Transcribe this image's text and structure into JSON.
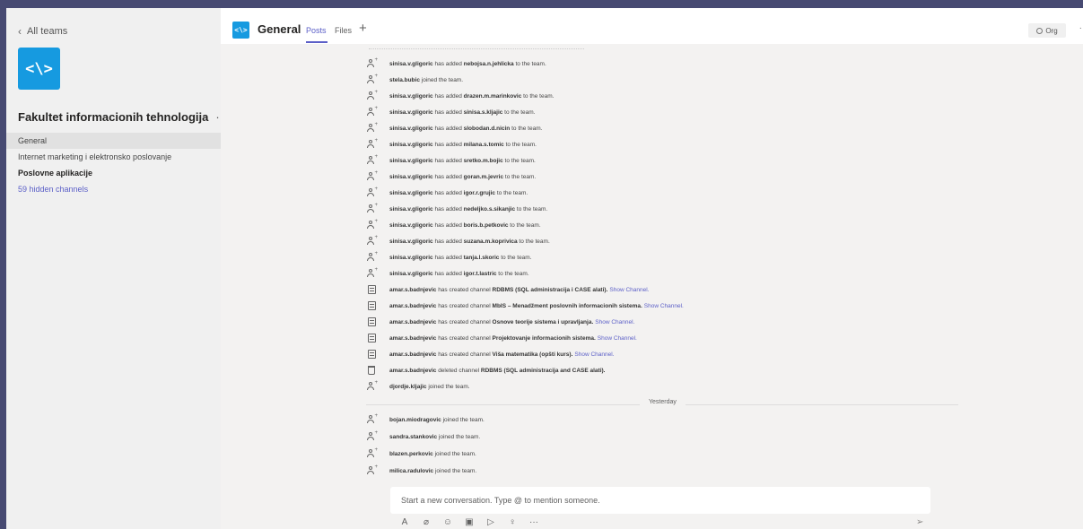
{
  "sidebar": {
    "back_label": "All teams",
    "team_avatar_glyph": "<\\>",
    "team_name": "Fakultet informacionih tehnologija",
    "team_more": "···",
    "channels": [
      {
        "label": "General"
      },
      {
        "label": "Internet marketing i elektronsko poslovanje"
      },
      {
        "label": "Poslovne aplikacije"
      },
      {
        "label": "59 hidden channels"
      }
    ]
  },
  "header": {
    "avatar_glyph": "<\\>",
    "title": "General",
    "tabs": [
      {
        "label": "Posts"
      },
      {
        "label": "Files"
      }
    ],
    "add_tab": "+",
    "org_label": "Org"
  },
  "feed": {
    "events": [
      {
        "icon": "user-add-icon",
        "user": "sinisa.v.gligoric",
        "text": " has added ",
        "target": "nebojsa.n.jehlicka",
        "tail": " to the team."
      },
      {
        "icon": "user-add-icon",
        "user": "stela.bubic",
        "text": " joined the team.",
        "target": "",
        "tail": ""
      },
      {
        "icon": "user-add-icon",
        "user": "sinisa.v.gligoric",
        "text": " has added ",
        "target": "drazen.m.marinkovic",
        "tail": " to the team."
      },
      {
        "icon": "user-add-icon",
        "user": "sinisa.v.gligoric",
        "text": " has added ",
        "target": "sinisa.s.kljajic",
        "tail": " to the team."
      },
      {
        "icon": "user-add-icon",
        "user": "sinisa.v.gligoric",
        "text": " has added ",
        "target": "slobodan.d.nicin",
        "tail": " to the team."
      },
      {
        "icon": "user-add-icon",
        "user": "sinisa.v.gligoric",
        "text": " has added ",
        "target": "milana.s.tomic",
        "tail": " to the team."
      },
      {
        "icon": "user-add-icon",
        "user": "sinisa.v.gligoric",
        "text": " has added ",
        "target": "sretko.m.bojic",
        "tail": " to the team."
      },
      {
        "icon": "user-add-icon",
        "user": "sinisa.v.gligoric",
        "text": " has added ",
        "target": "goran.m.jevric",
        "tail": " to the team."
      },
      {
        "icon": "user-add-icon",
        "user": "sinisa.v.gligoric",
        "text": " has added ",
        "target": "igor.r.grujic",
        "tail": " to the team."
      },
      {
        "icon": "user-add-icon",
        "user": "sinisa.v.gligoric",
        "text": " has added ",
        "target": "nedeljko.s.sikanjic",
        "tail": " to the team."
      },
      {
        "icon": "user-add-icon",
        "user": "sinisa.v.gligoric",
        "text": " has added ",
        "target": "boris.b.petkovic",
        "tail": " to the team."
      },
      {
        "icon": "user-add-icon",
        "user": "sinisa.v.gligoric",
        "text": " has added ",
        "target": "suzana.m.koprivica",
        "tail": " to the team."
      },
      {
        "icon": "user-add-icon",
        "user": "sinisa.v.gligoric",
        "text": " has added ",
        "target": "tanja.l.skoric",
        "tail": " to the team."
      },
      {
        "icon": "user-add-icon",
        "user": "sinisa.v.gligoric",
        "text": " has added ",
        "target": "igor.t.lastric",
        "tail": " to the team."
      },
      {
        "icon": "channel-icon",
        "user": "amar.s.badnjevic",
        "text": " has created channel ",
        "target": "RDBMS (SQL administracija i CASE alati).",
        "tail": "",
        "link": "Show Channel."
      },
      {
        "icon": "channel-icon",
        "user": "amar.s.badnjevic",
        "text": " has created channel ",
        "target": "MbIS – Menadžment poslovnih informacionih sistema.",
        "tail": "",
        "link": "Show Channel."
      },
      {
        "icon": "channel-icon",
        "user": "amar.s.badnjevic",
        "text": " has created channel ",
        "target": "Osnove teorije sistema i upravljanja.",
        "tail": "",
        "link": "Show Channel."
      },
      {
        "icon": "channel-icon",
        "user": "amar.s.badnjevic",
        "text": " has created channel ",
        "target": "Projektovanje informacionih sistema.",
        "tail": "",
        "link": "Show Channel."
      },
      {
        "icon": "channel-icon",
        "user": "amar.s.badnjevic",
        "text": " has created channel ",
        "target": "Viša matematika (opšti kurs).",
        "tail": "",
        "link": "Show Channel."
      },
      {
        "icon": "trash-icon",
        "user": "amar.s.badnjevic",
        "text": " deleted channel ",
        "target": "RDBMS (SQL administracija and CASE alati).",
        "tail": ""
      },
      {
        "icon": "user-add-icon",
        "user": "djordje.kljajic",
        "text": " joined the team.",
        "target": "",
        "tail": ""
      }
    ],
    "divider_label": "Yesterday",
    "events_after": [
      {
        "icon": "user-add-icon",
        "user": "bojan.miodragovic",
        "text": " joined the team."
      },
      {
        "icon": "user-add-icon",
        "user": "sandra.stankovic",
        "text": " joined the team."
      },
      {
        "icon": "user-add-icon",
        "user": "blazen.perkovic",
        "text": " joined the team."
      },
      {
        "icon": "user-add-icon",
        "user": "milica.radulovic",
        "text": " joined the team."
      }
    ]
  },
  "composer": {
    "placeholder": "Start a new conversation. Type @ to mention someone.",
    "tools": [
      {
        "icon": "format-icon",
        "glyph": "A"
      },
      {
        "icon": "attach-icon",
        "glyph": "⌀"
      },
      {
        "icon": "emoji-icon",
        "glyph": "☺"
      },
      {
        "icon": "gif-icon",
        "glyph": "▣"
      },
      {
        "icon": "sticker-icon",
        "glyph": "▷"
      },
      {
        "icon": "praise-icon",
        "glyph": "♀"
      },
      {
        "icon": "more-icon",
        "glyph": "···"
      }
    ],
    "send_glyph": "➢"
  }
}
